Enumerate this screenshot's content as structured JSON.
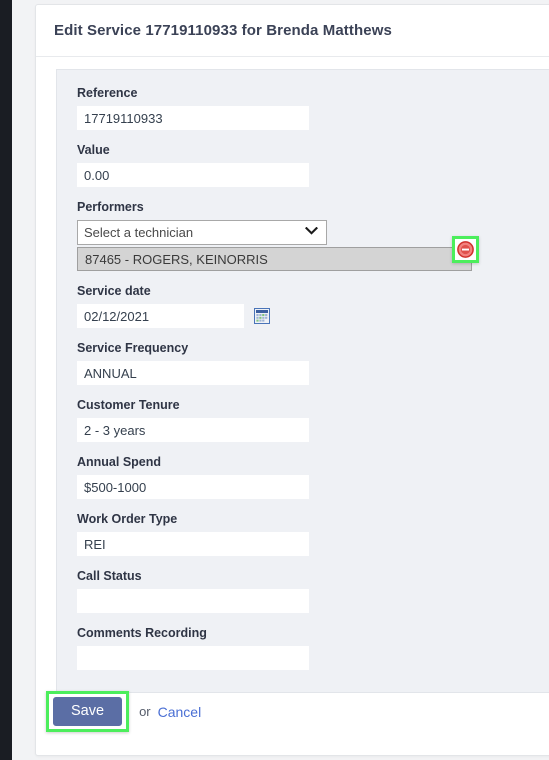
{
  "window": {
    "background_color": "#f2f3f5",
    "rail_color": "#1a1d23"
  },
  "card": {
    "title": "Edit Service 17719110933 for Brenda Matthews"
  },
  "form": {
    "fields": [
      {
        "label": "Reference",
        "value": "17719110933",
        "type": "text"
      },
      {
        "label": "Value",
        "value": "0.00",
        "type": "text"
      },
      {
        "label": "Performers",
        "value": "",
        "type": "performers"
      },
      {
        "label": "Service date",
        "value": "02/12/2021",
        "type": "date"
      },
      {
        "label": "Service Frequency",
        "value": "ANNUAL",
        "type": "text"
      },
      {
        "label": "Customer Tenure",
        "value": "2 - 3 years",
        "type": "text"
      },
      {
        "label": "Annual Spend",
        "value": "$500-1000",
        "type": "text"
      },
      {
        "label": "Work Order Type",
        "value": "REI",
        "type": "text"
      },
      {
        "label": "Call Status",
        "value": "",
        "type": "text"
      },
      {
        "label": "Comments Recording",
        "value": "",
        "type": "text"
      }
    ],
    "performers": {
      "select_placeholder": "Select a technician",
      "selected": [
        {
          "text": "87465 - ROGERS, KEINORRIS",
          "remove_icon": "remove-circle-icon"
        }
      ]
    },
    "date_picker_icon": "calendar-icon"
  },
  "footer": {
    "save_label": "Save",
    "or_label": "or",
    "cancel_label": "Cancel",
    "save_color": "#5b6ea5",
    "cancel_color": "#4a6fd4"
  },
  "highlights": {
    "color": "#4cee5c",
    "targets": [
      "remove-performer-button",
      "save-button"
    ]
  }
}
